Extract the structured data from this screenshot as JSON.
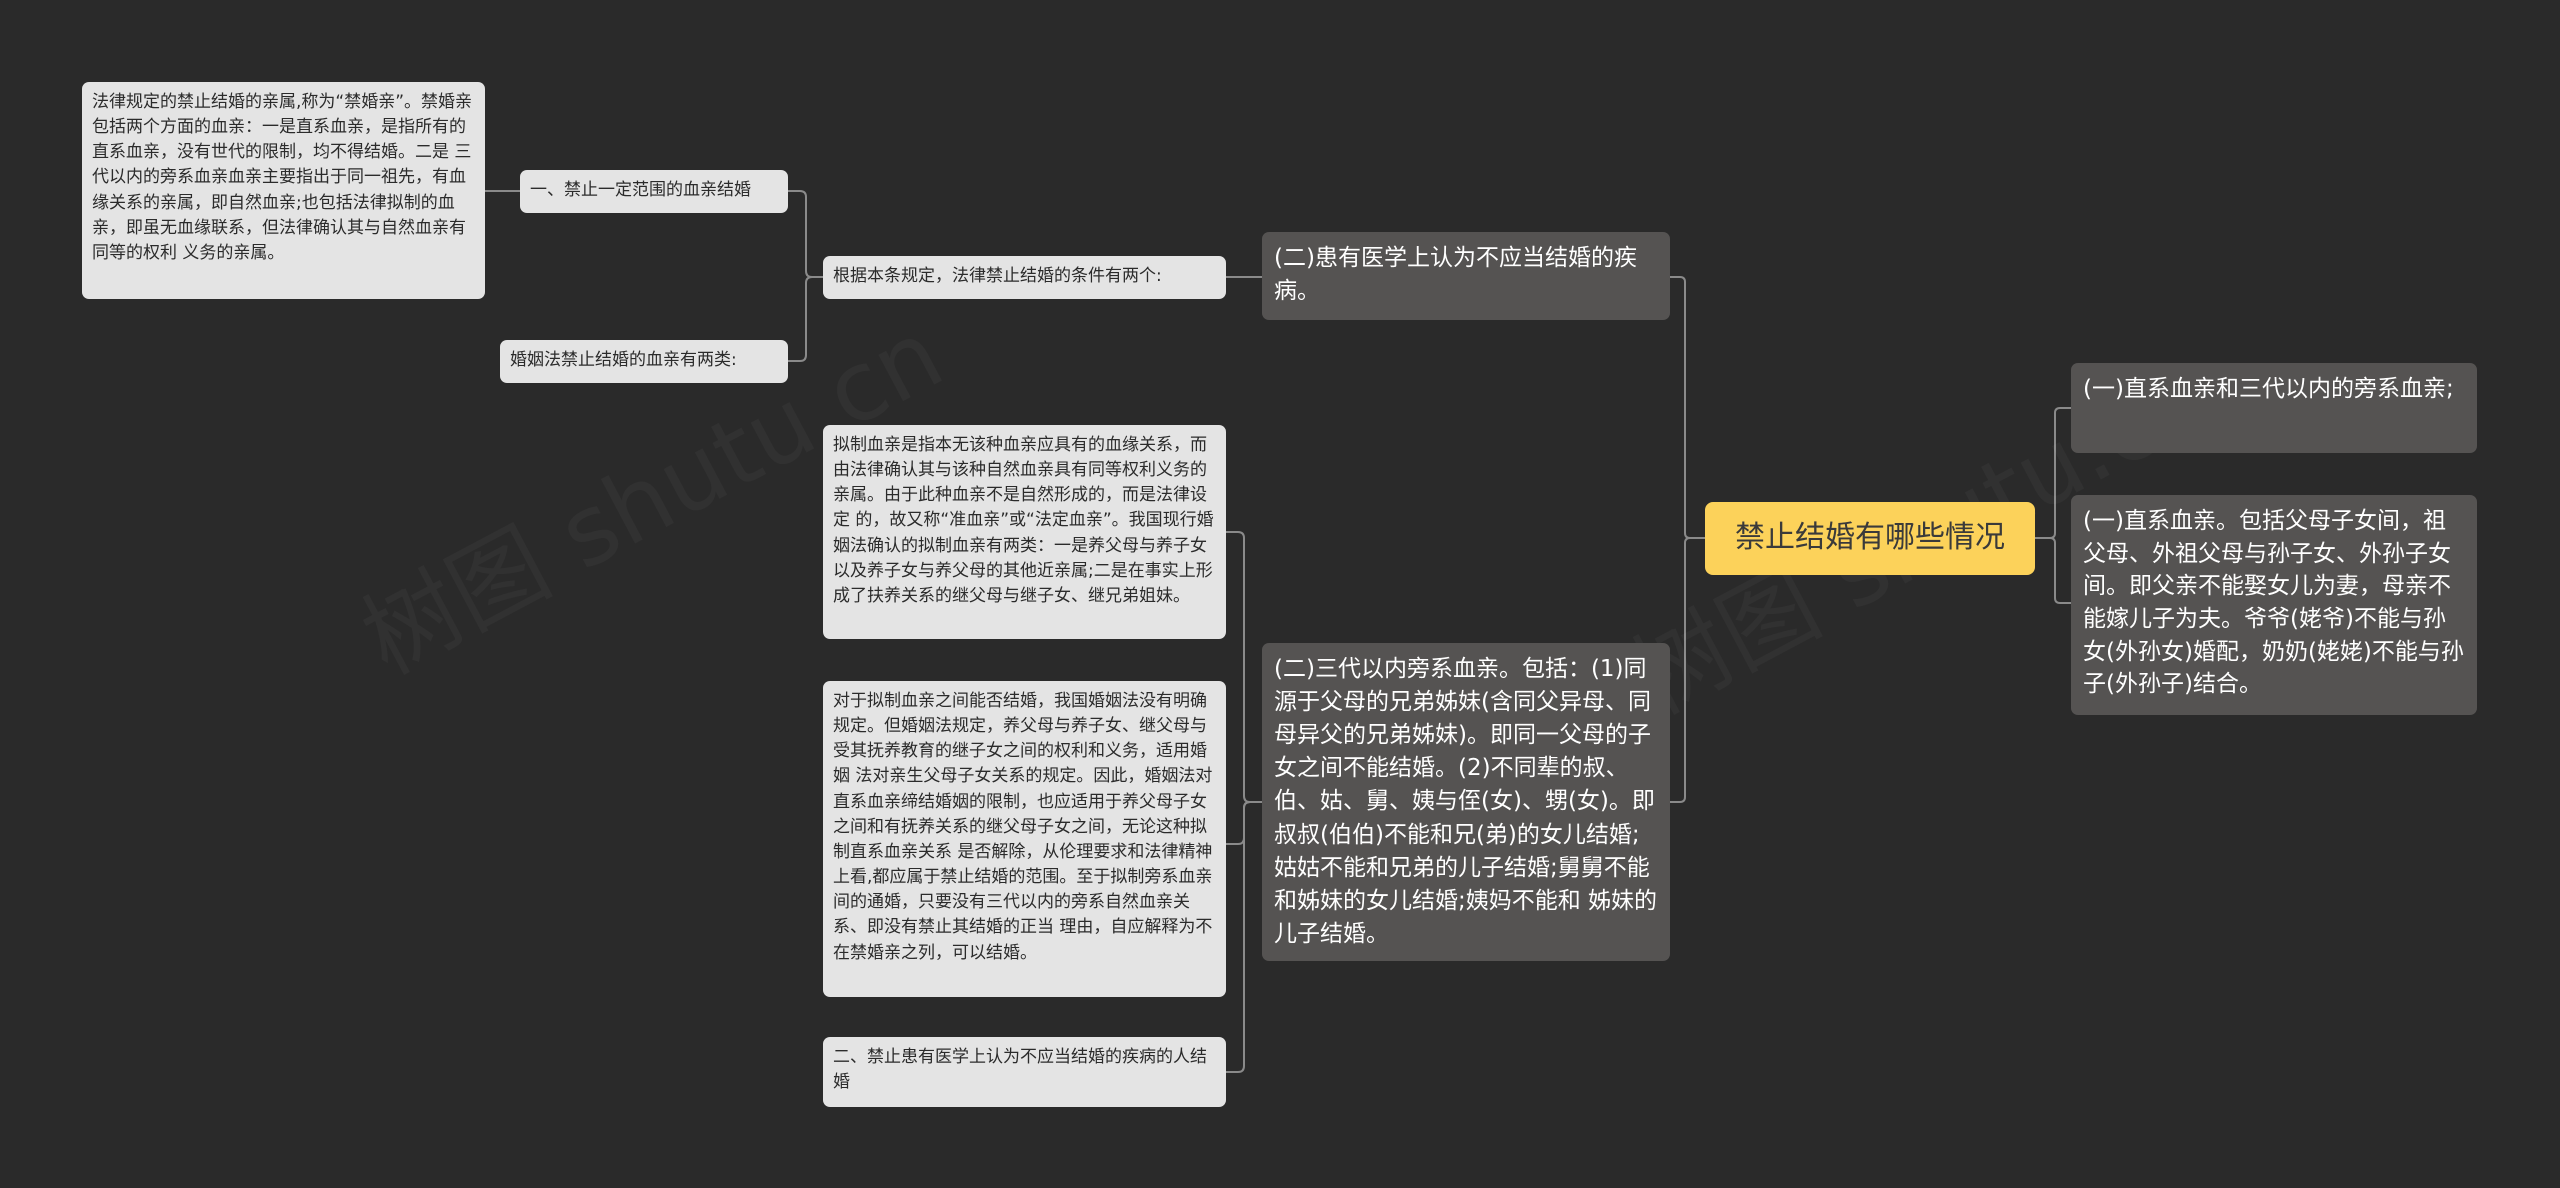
{
  "watermark": "树图 shutu.cn",
  "root": {
    "text": "禁止结婚有哪些情况"
  },
  "right_branches": [
    {
      "text": "(一)直系血亲和三代以内的旁系血亲;"
    },
    {
      "text": "(一)直系血亲。包括父母子女间，祖父母、外祖父母与孙子女、外孙子女间。即父亲不能娶女儿为妻，母亲不能嫁儿子为夫。爷爷(姥爷)不能与孙女(外孙女)婚配，奶奶(姥姥)不能与孙子(外孙子)结合。"
    }
  ],
  "left_branches": [
    {
      "text": "(二)患有医学上认为不应当结婚的疾病。"
    },
    {
      "text": "(二)三代以内旁系血亲。包括：(1)同源于父母的兄弟姊妹(含同父异母、同母异父的兄弟姊妹)。即同一父母的子女之间不能结婚。(2)不同辈的叔、伯、姑、舅、姨与侄(女)、甥(女)。即叔叔(伯伯)不能和兄(弟)的女儿结婚;姑姑不能和兄弟的儿子结婚;舅舅不能和姊妹的女儿结婚;姨妈不能和 姊妹的儿子结婚。"
    }
  ],
  "sub_nodes": {
    "conditions": "根据本条规定，法律禁止结婚的条件有两个:",
    "rule_one": "一、禁止一定范围的血亲结婚",
    "rule_one_detail": "法律规定的禁止结婚的亲属,称为“禁婚亲”。禁婚亲包括两个方面的血亲：一是直系血亲，是指所有的直系血亲，没有世代的限制，均不得结婚。二是 三代以内的旁系血亲血亲主要指出于同一祖先，有血缘关系的亲属，即自然血亲;也包括法律拟制的血亲，即虽无血缘联系，但法律确认其与自然血亲有同等的权利 义务的亲属。",
    "two_kinds": "婚姻法禁止结婚的血亲有两类:",
    "fictive_kin": "拟制血亲是指本无该种血亲应具有的血缘关系，而由法律确认其与该种自然血亲具有同等权利义务的亲属。由于此种血亲不是自然形成的，而是法律设定 的，故又称“准血亲”或“法定血亲”。我国现行婚姻法确认的拟制血亲有两类：一是养父母与养子女以及养子女与养父母的其他近亲属;二是在事实上形成了扶养关系的继父母与继子女、继兄弟姐妹。",
    "fictive_marriage": "对于拟制血亲之间能否结婚，我国婚姻法没有明确规定。但婚姻法规定，养父母与养子女、继父母与受其抚养教育的继子女之间的权利和义务，适用婚姻 法对亲生父母子女关系的规定。因此，婚姻法对直系血亲缔结婚姻的限制，也应适用于养父母子女之间和有抚养关系的继父母子女之间，无论这种拟制直系血亲关系 是否解除，从伦理要求和法律精神上看,都应属于禁止结婚的范围。至于拟制旁系血亲间的通婚，只要没有三代以内的旁系自然血亲关系、即没有禁止其结婚的正当 理由，自应解释为不在禁婚亲之列，可以结婚。",
    "rule_two": "二、禁止患有医学上认为不应当结婚的疾病的人结婚"
  }
}
